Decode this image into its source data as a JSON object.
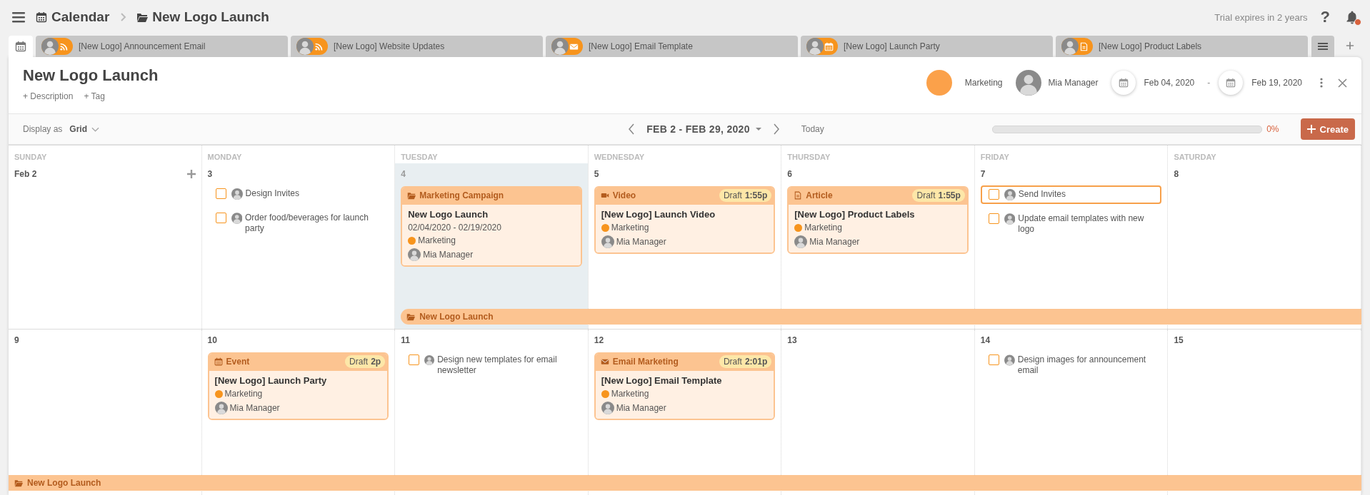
{
  "top_bar": {
    "breadcrumb": [
      {
        "kind": "calendar",
        "label": "Calendar"
      },
      {
        "kind": "folder",
        "label": "New Logo Launch"
      }
    ],
    "trial_notice": "Trial expires in 2 years",
    "help": "?",
    "notifications": {
      "unread": true
    }
  },
  "tabs": [
    {
      "kind": "calendar",
      "selected": true
    },
    {
      "kind": "rss",
      "label": "[New Logo] Announcement Email",
      "selected": false
    },
    {
      "kind": "rss",
      "label": "[New Logo] Website Updates",
      "selected": false
    },
    {
      "kind": "email",
      "label": "[New Logo] Email Template",
      "selected": false
    },
    {
      "kind": "event",
      "label": "[New Logo] Launch Party",
      "selected": false
    },
    {
      "kind": "article",
      "label": "[New Logo] Product Labels",
      "selected": false
    }
  ],
  "project": {
    "title": "New Logo Launch",
    "add_links": [
      "+ Description",
      "+ Tag"
    ],
    "team": "Marketing",
    "owner": "Mia Manager",
    "start_date": "Feb 04, 2020",
    "date_separator": "-",
    "end_date": "Feb 19, 2020"
  },
  "toolbar": {
    "display_as_label": "Display as",
    "display_mode": "Grid",
    "range": "FEB 2 - FEB 29, 2020",
    "today": "Today",
    "progress": {
      "level": 0,
      "reading": "0%"
    },
    "create": "Create"
  },
  "weeks": [
    {
      "days": [
        {
          "day_name": "SUNDAY",
          "date": "Feb 2",
          "today": false,
          "add_button": true
        },
        {
          "day_name": "MONDAY",
          "date": "3",
          "today": false,
          "add_button": false,
          "items": [
            {
              "kind": "task",
              "title": "Design Invites",
              "checked": false,
              "selected": false
            },
            {
              "kind": "task",
              "title": "Order food/beverages for launch party",
              "checked": false,
              "selected": false
            }
          ]
        },
        {
          "day_name": "TUESDAY",
          "date": "4",
          "today": true,
          "add_button": false,
          "items": [
            {
              "kind": "campaign",
              "type_label": "Marketing Campaign",
              "title": "New Logo Launch",
              "dates": "02/04/2020 - 02/19/2020",
              "tag": "Marketing",
              "assignee": "Mia Manager"
            }
          ],
          "bar": {
            "label": "New Logo Launch",
            "starts_here": true
          }
        },
        {
          "day_name": "WEDNESDAY",
          "date": "5",
          "today": false,
          "add_button": false,
          "items": [
            {
              "kind": "video",
              "type_label": "Video",
              "status": "Draft",
              "time": "1:55p",
              "title": "[New Logo] Launch Video",
              "tag": "Marketing",
              "assignee": "Mia Manager"
            }
          ]
        },
        {
          "day_name": "THURSDAY",
          "date": "6",
          "today": false,
          "add_button": false,
          "items": [
            {
              "kind": "article",
              "type_label": "Article",
              "status": "Draft",
              "time": "1:55p",
              "title": "[New Logo] Product Labels",
              "tag": "Marketing",
              "assignee": "Mia Manager"
            }
          ]
        },
        {
          "day_name": "FRIDAY",
          "date": "7",
          "today": false,
          "add_button": false,
          "items": [
            {
              "kind": "task",
              "title": "Send Invites",
              "checked": false,
              "selected": true
            },
            {
              "kind": "task",
              "title": "Update email templates with new logo",
              "checked": false,
              "selected": false
            }
          ]
        },
        {
          "day_name": "SATURDAY",
          "date": "8",
          "today": false,
          "add_button": false
        }
      ]
    },
    {
      "days": [
        {
          "date": "9",
          "today": false,
          "add_button": false,
          "bar": {
            "label": "New Logo Launch",
            "starts_here": false
          }
        },
        {
          "date": "10",
          "today": false,
          "add_button": false,
          "items": [
            {
              "kind": "event",
              "type_label": "Event",
              "status": "Draft",
              "time": "2p",
              "title": "[New Logo] Launch Party",
              "tag": "Marketing",
              "assignee": "Mia Manager"
            }
          ]
        },
        {
          "date": "11",
          "today": false,
          "add_button": false,
          "items": [
            {
              "kind": "task",
              "title": "Design new templates for email newsletter",
              "checked": false,
              "selected": false
            }
          ]
        },
        {
          "date": "12",
          "today": false,
          "add_button": false,
          "items": [
            {
              "kind": "email",
              "type_label": "Email Marketing",
              "status": "Draft",
              "time": "2:01p",
              "title": "[New Logo] Email Template",
              "tag": "Marketing",
              "assignee": "Mia Manager"
            }
          ]
        },
        {
          "date": "13",
          "today": false,
          "add_button": false
        },
        {
          "date": "14",
          "today": false,
          "add_button": false,
          "items": [
            {
              "kind": "task",
              "title": "Design images for announcement email",
              "checked": false,
              "selected": false
            }
          ]
        },
        {
          "date": "15",
          "today": false,
          "add_button": false
        }
      ]
    }
  ]
}
